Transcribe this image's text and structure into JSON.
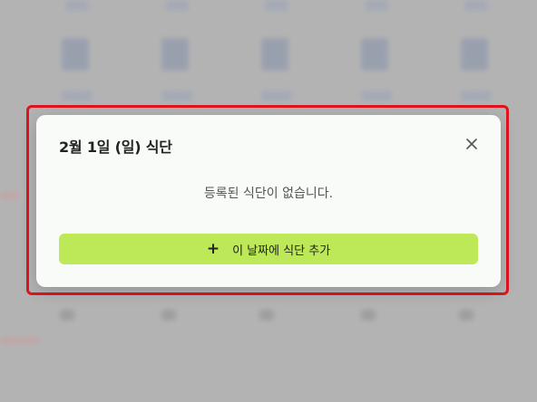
{
  "modal": {
    "title": "2월 1일 (일) 식단",
    "close_icon": "close-icon",
    "empty_message": "등록된 식단이 없습니다.",
    "add_button_icon": "+",
    "add_button_label": "이 날짜에 식단 추가"
  },
  "colors": {
    "highlight": "#e0141e",
    "add_button": "#bde858",
    "modal_bg": "#f9fbf9"
  }
}
